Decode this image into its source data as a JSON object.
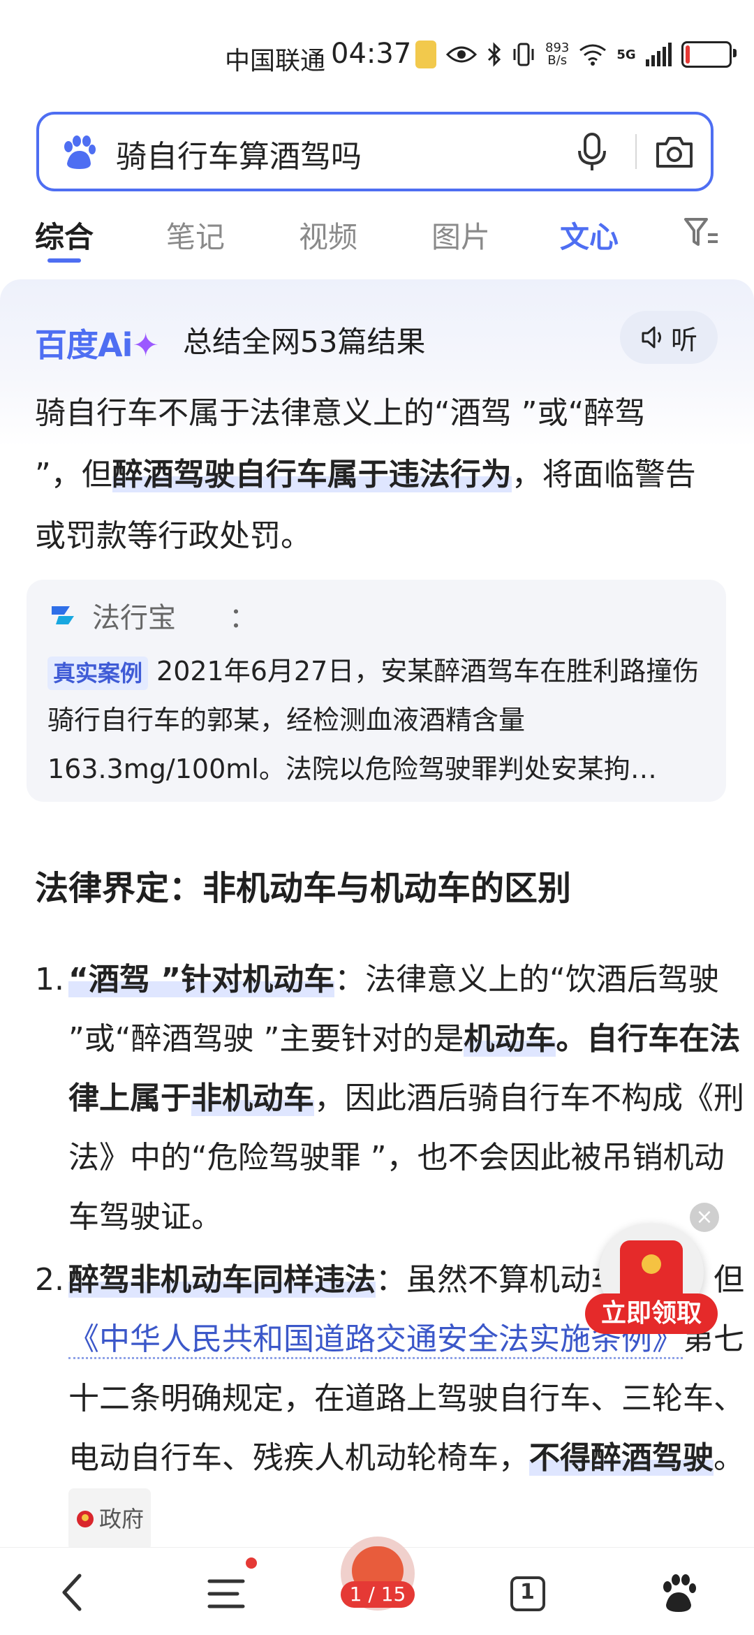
{
  "status_bar": {
    "carrier": "中国联通",
    "time": "04:37",
    "net_speed": "893",
    "net_unit": "B/s",
    "network": "5G"
  },
  "search": {
    "query": "骑自行车算酒驾吗"
  },
  "tabs": [
    {
      "label": "综合"
    },
    {
      "label": "笔记"
    },
    {
      "label": "视频"
    },
    {
      "label": "图片"
    },
    {
      "label": "文心"
    }
  ],
  "ai_card": {
    "logo": "百度Ai",
    "heading": "总结全网53篇结果",
    "listen_label": "听",
    "summary_1": "骑自行车不属于法律意义上的“酒驾 ”或“醉驾 ”，但",
    "summary_hl": "醉酒驾驶自行车属于违法行为",
    "summary_2": "，将面临警告或罚款等行政处罚。"
  },
  "case_card": {
    "source": "法行宝",
    "colon": "：",
    "tag": "真实案例",
    "text": "2021年6月27日，安某醉酒驾车在胜利路撞伤骑行自行车的郭某，经检测血液酒精含量163.3mg/100ml。法院以危险驾驶罪判处安某拘…"
  },
  "section": {
    "title": "法律界定：非机动车与机动车的区别",
    "item1": {
      "num": "1.",
      "lead": "“酒驾 ”针对机动车",
      "p1": "：法律意义上的“饮酒后驾驶 ”或“醉酒驾驶 ”主要针对的是",
      "b1": "机动车",
      "p2": "。",
      "b2a": "自行车在法律上属于",
      "b2b": "非机动车",
      "p3": "，因此酒后骑自行车不构成《刑法》中的“危险驾驶罪 ”，也不会因此被吊销机动车驾驶证。"
    },
    "item2": {
      "num": "2.",
      "lead": "醉驾非机动车同样违法",
      "p1": "：虽然不算机动车酒驾，但",
      "link": "《中华人民共和国道路交通安全法实施条例》",
      "p2": "第七十二条明确规定，在道路上驾驶自行车、三轮车、电动自行车、残疾人机动轮椅车，",
      "b1": "不得醉酒驾驶",
      "p3": "。",
      "badge": "政府"
    }
  },
  "float_promo": {
    "button": "立即领取"
  },
  "bottom_nav": {
    "tab_count": "1",
    "page_counter": "1 / 15"
  }
}
